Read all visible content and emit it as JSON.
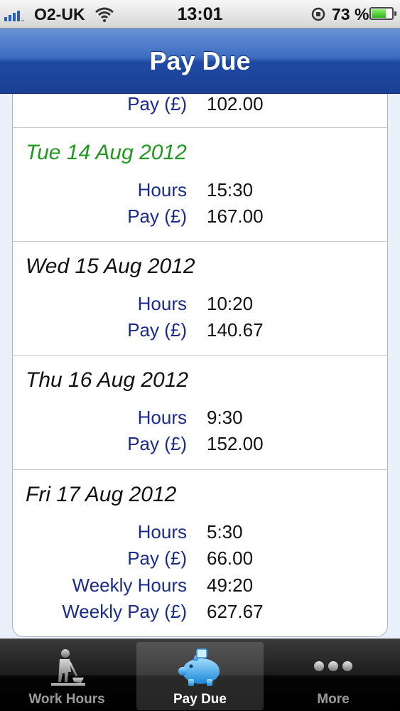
{
  "status_bar": {
    "carrier": "O2-UK",
    "time": "13:01",
    "battery": "73 %",
    "battery_level": 0.73,
    "icons": [
      "signal-icon",
      "wifi-icon",
      "rotation-lock-icon",
      "battery-icon"
    ]
  },
  "nav": {
    "title": "Pay Due"
  },
  "partial_row": {
    "label": "Pay (£)",
    "value": "102.00"
  },
  "days": [
    {
      "date": "Tue 14 Aug 2012",
      "highlight": true,
      "rows": [
        {
          "label": "Hours",
          "value": "15:30"
        },
        {
          "label": "Pay (£)",
          "value": "167.00"
        }
      ]
    },
    {
      "date": "Wed 15 Aug 2012",
      "highlight": false,
      "rows": [
        {
          "label": "Hours",
          "value": "10:20"
        },
        {
          "label": "Pay (£)",
          "value": "140.67"
        }
      ]
    },
    {
      "date": "Thu 16 Aug 2012",
      "highlight": false,
      "rows": [
        {
          "label": "Hours",
          "value": "9:30"
        },
        {
          "label": "Pay (£)",
          "value": "152.00"
        }
      ]
    },
    {
      "date": "Fri 17 Aug 2012",
      "highlight": false,
      "rows": [
        {
          "label": "Hours",
          "value": "5:30"
        },
        {
          "label": "Pay (£)",
          "value": "66.00"
        },
        {
          "label": "Weekly Hours",
          "value": "49:20"
        },
        {
          "label": "Weekly Pay (£)",
          "value": "627.67"
        }
      ]
    }
  ],
  "tabs": [
    {
      "label": "Work Hours",
      "icon": "worker-digging-icon",
      "active": false
    },
    {
      "label": "Pay Due",
      "icon": "piggy-bank-icon",
      "active": true
    },
    {
      "label": "More",
      "icon": "more-dots-icon",
      "active": false
    }
  ],
  "colors": {
    "highlight_date": "#1f9a1f",
    "label": "#1a2b8c",
    "nav_bar": "#2f5cb5"
  }
}
